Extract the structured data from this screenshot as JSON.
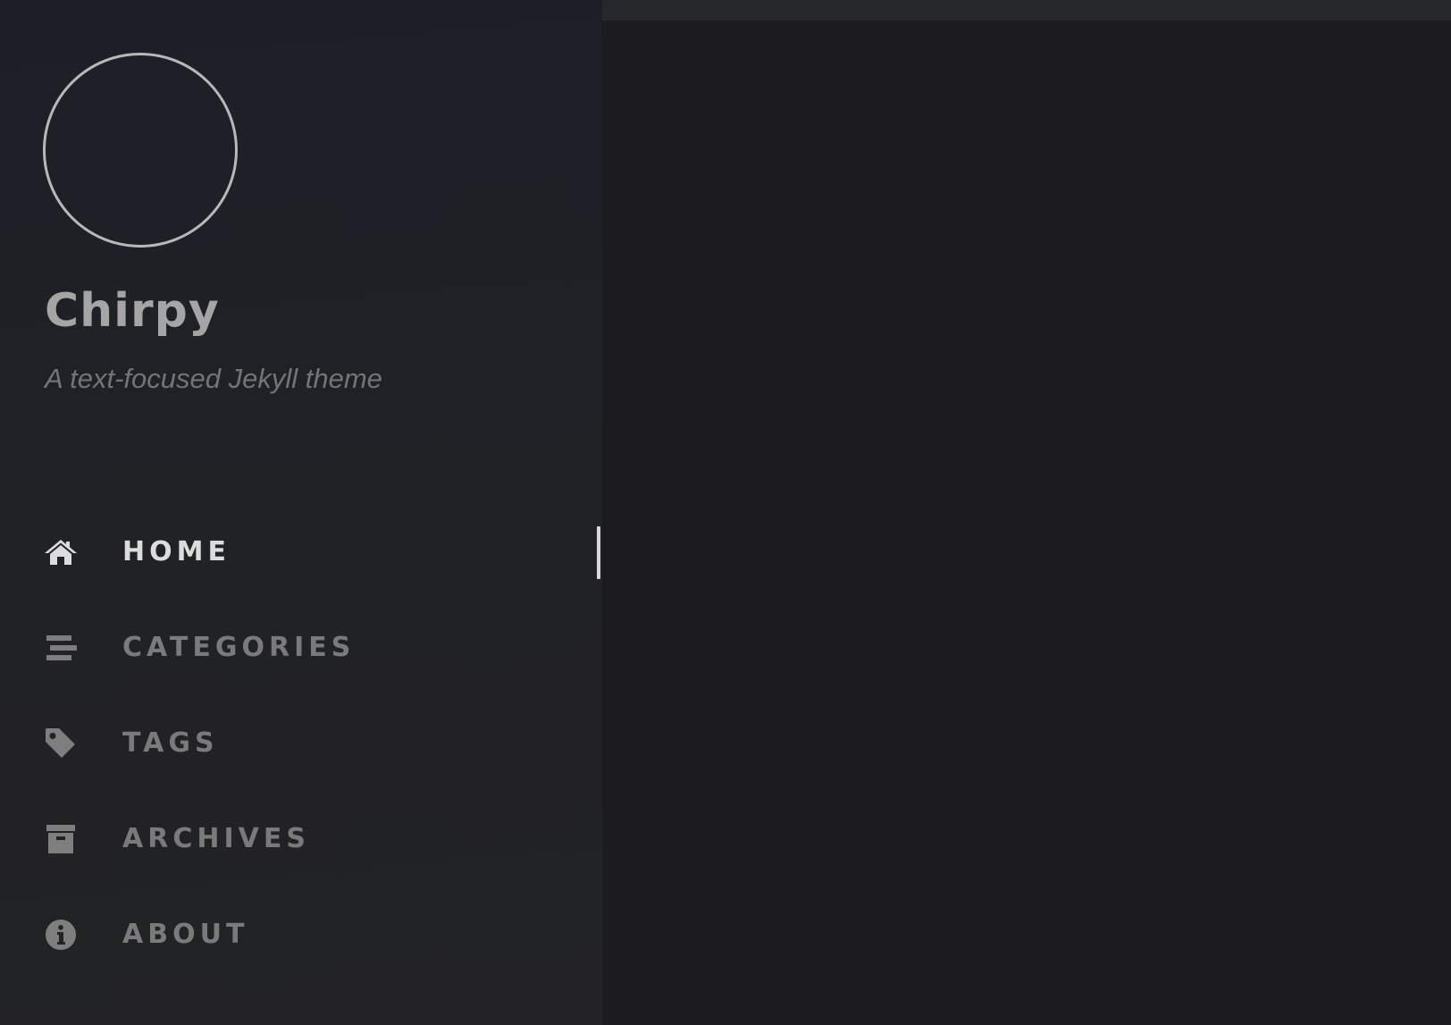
{
  "site": {
    "title": "Chirpy",
    "subtitle": "A text-focused Jekyll theme"
  },
  "nav": {
    "items": [
      {
        "label": "HOME",
        "icon": "home-icon",
        "active": true
      },
      {
        "label": "CATEGORIES",
        "icon": "stream-icon",
        "active": false
      },
      {
        "label": "TAGS",
        "icon": "tag-icon",
        "active": false
      },
      {
        "label": "ARCHIVES",
        "icon": "archive-icon",
        "active": false
      },
      {
        "label": "ABOUT",
        "icon": "info-circle-icon",
        "active": false
      }
    ]
  },
  "colors": {
    "sidebar_bg": "#1f2025",
    "main_bg": "#1c1c1e",
    "topbar_bg": "#26272b",
    "active_text": "#dcdcdc",
    "inactive_text": "#7a7a7a"
  }
}
